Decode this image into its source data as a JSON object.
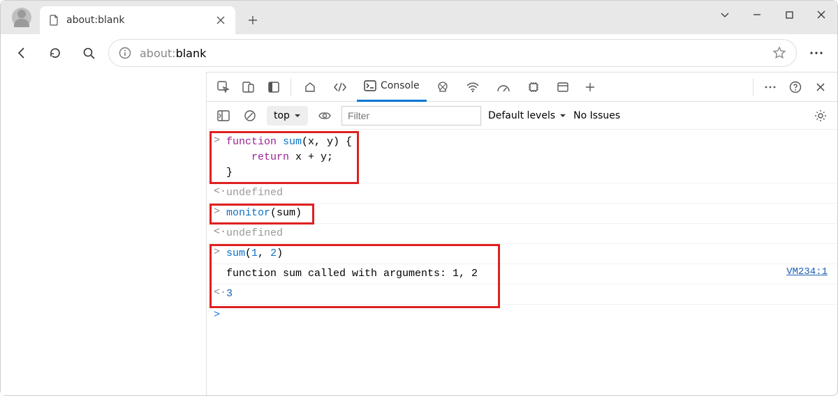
{
  "tab": {
    "title": "about:blank"
  },
  "address": {
    "prefix": "about:",
    "page": "blank"
  },
  "devtools": {
    "tabs": {
      "console": "Console"
    },
    "console_bar": {
      "context": "top",
      "filter_placeholder": "Filter",
      "levels": "Default levels",
      "issues": "No Issues"
    },
    "log": {
      "in1_l1a": "function",
      "in1_l1b": " ",
      "in1_l1c": "sum",
      "in1_l1d": "(x, y) {",
      "in1_l2a": "    ",
      "in1_l2b": "return",
      "in1_l2c": " x + y;",
      "in1_l3": "}",
      "out1": "undefined",
      "in2a": "monitor",
      "in2b": "(sum)",
      "out2": "undefined",
      "in3a": "sum",
      "in3b": "(",
      "in3c": "1",
      "in3d": ", ",
      "in3e": "2",
      "in3f": ")",
      "msg": "function sum called with arguments: 1, 2",
      "msg_src": "VM234:1",
      "out3": "3"
    }
  }
}
